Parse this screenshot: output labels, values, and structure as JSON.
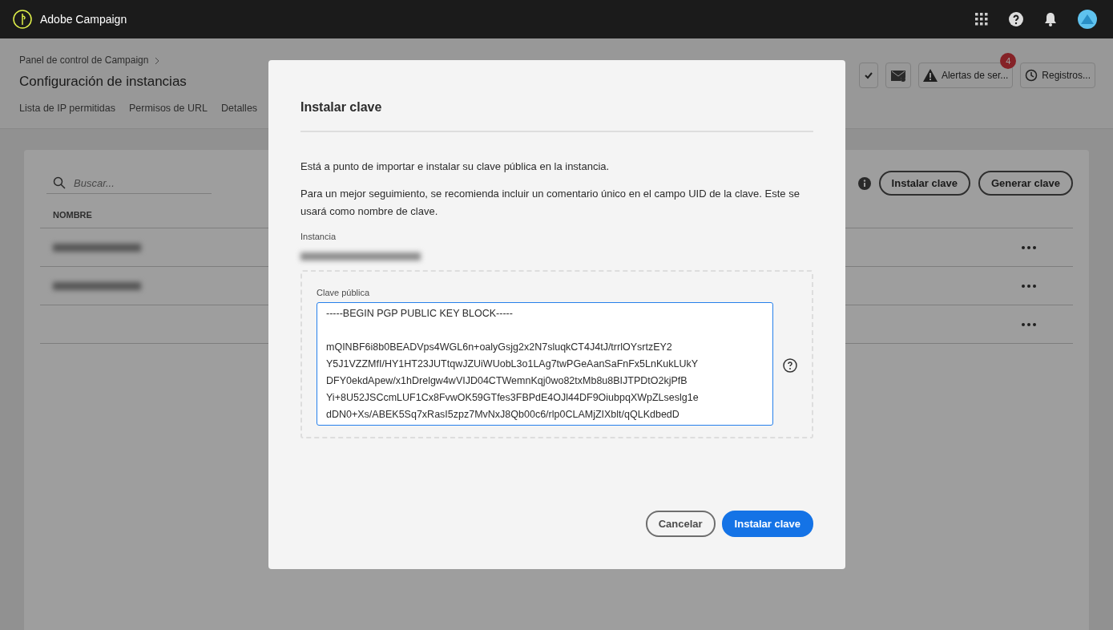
{
  "app": {
    "name": "Adobe Campaign"
  },
  "header": {
    "breadcrumb": "Panel de control de Campaign",
    "title": "Configuración de instancias",
    "tabs": [
      {
        "label": "Lista de IP permitidas",
        "selected": false
      },
      {
        "label": "Permisos de URL",
        "selected": false
      },
      {
        "label": "Detalles",
        "selected": false
      }
    ],
    "actions": [
      {
        "kind": "check"
      },
      {
        "kind": "mail"
      },
      {
        "kind": "alerts",
        "label": "Alertas de ser...",
        "badge": "4"
      },
      {
        "kind": "logs",
        "label": "Registros..."
      }
    ]
  },
  "list": {
    "search_placeholder": "Buscar...",
    "buttons": [
      "Instalar clave",
      "Generar clave"
    ],
    "column": "NOMBRE",
    "rows": [
      {
        "blurred": true
      },
      {
        "blurred": true
      },
      {
        "blurred": false
      }
    ]
  },
  "dialog": {
    "title": "Instalar clave",
    "intro": "Está a punto de importar e instalar su clave pública en la instancia.",
    "note": "Para un mejor seguimiento, se recomienda incluir un comentario único en el campo UID de la clave. Este se usará como nombre de clave.",
    "instance_label": "Instancia",
    "key_label": "Clave pública",
    "key_text": "-----BEGIN PGP PUBLIC KEY BLOCK-----\n\nmQINBF6i8b0BEADVps4WGL6n+oalyGsjg2x2N7sluqkCT4J4tJ/trrlOYsrtzEY2\nY5J1VZZMfI/HY1HT23JUTtqwJZUiWUobL3o1LAg7twPGeAanSaFnFx5LnKukLUkY\nDFY0ekdApew/x1hDrelgw4wVIJD04CTWemnKqj0wo82txMb8u8BIJTPDtO2kjPfB\nYi+8U52JSCcmLUF1Cx8FvwOK59GTfes3FBPdE4OJl44DF9OiubpqXWpZLseslg1e\ndDN0+Xs/ABEK5Sq7xRasI5zpz7MvNxJ8Qb00c6/rlp0CLAMjZIXblt/qQLKdbedD",
    "buttons": [
      {
        "kind": "secondary",
        "label": "Cancelar"
      },
      {
        "kind": "primary",
        "label": "Instalar clave"
      }
    ]
  }
}
